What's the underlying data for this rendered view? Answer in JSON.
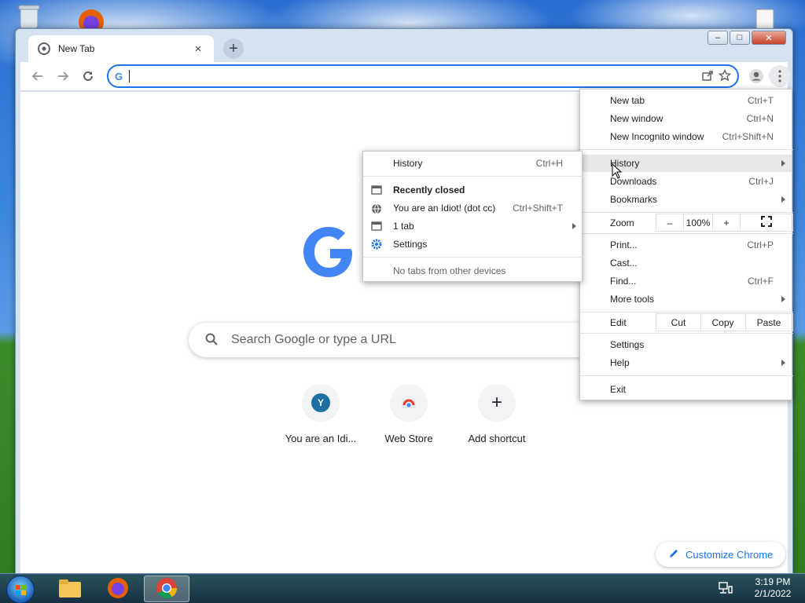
{
  "window": {
    "tab_title": "New Tab",
    "close_tab_glyph": "×",
    "new_tab_glyph": "+",
    "minimize_glyph": "–",
    "maximize_glyph": "□",
    "close_glyph": "✕"
  },
  "omnibox": {
    "g_glyph": "G"
  },
  "ntp": {
    "search_placeholder": "Search Google or type a URL",
    "shortcuts": [
      {
        "label": "You are an Idi...",
        "icon_letter": "Y"
      },
      {
        "label": "Web Store"
      },
      {
        "label": "Add shortcut",
        "icon_glyph": "+"
      }
    ],
    "customize_label": "Customize Chrome"
  },
  "main_menu": {
    "items": [
      {
        "label": "New tab",
        "shortcut": "Ctrl+T"
      },
      {
        "label": "New window",
        "shortcut": "Ctrl+N"
      },
      {
        "label": "New Incognito window",
        "shortcut": "Ctrl+Shift+N"
      },
      {
        "label": "History"
      },
      {
        "label": "Downloads",
        "shortcut": "Ctrl+J"
      },
      {
        "label": "Bookmarks"
      },
      {
        "label": "Zoom"
      },
      {
        "label": "Print...",
        "shortcut": "Ctrl+P"
      },
      {
        "label": "Cast..."
      },
      {
        "label": "Find...",
        "shortcut": "Ctrl+F"
      },
      {
        "label": "More tools"
      },
      {
        "label": "Edit"
      },
      {
        "label": "Settings"
      },
      {
        "label": "Help"
      },
      {
        "label": "Exit"
      }
    ],
    "zoom": {
      "minus": "–",
      "value": "100%",
      "plus": "+"
    },
    "edit": {
      "cut": "Cut",
      "copy": "Copy",
      "paste": "Paste"
    }
  },
  "history_menu": {
    "history_label": "History",
    "history_shortcut": "Ctrl+H",
    "recently_closed": "Recently closed",
    "items": [
      {
        "label": "You are an Idiot! (dot cc)",
        "shortcut": "Ctrl+Shift+T"
      },
      {
        "label": "1 tab"
      },
      {
        "label": "Settings"
      }
    ],
    "no_tabs": "No tabs from other devices"
  },
  "taskbar": {
    "time": "3:19 PM",
    "date": "2/1/2022"
  },
  "colors": {
    "accent": "#1a73e8",
    "google_blue": "#4285f4",
    "google_red": "#ea4335"
  }
}
